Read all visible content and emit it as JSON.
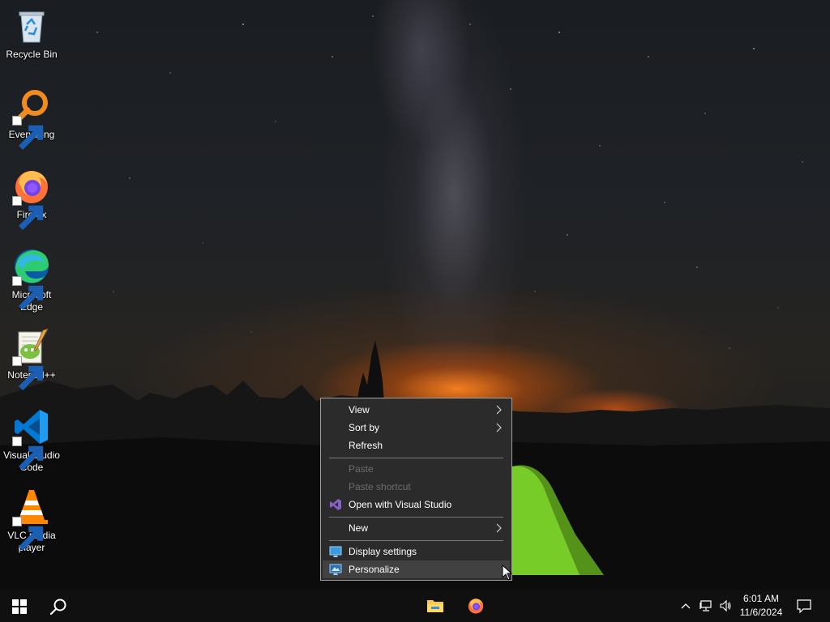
{
  "desktop": {
    "icons": [
      {
        "label": "Recycle Bin",
        "icon": "recycle-bin-icon"
      },
      {
        "label": "Everything",
        "icon": "everything-search-icon"
      },
      {
        "label": "Firefox",
        "icon": "firefox-icon"
      },
      {
        "label": "Microsoft Edge",
        "icon": "edge-icon"
      },
      {
        "label": "Notepad++",
        "icon": "notepad-plus-plus-icon"
      },
      {
        "label": "Visual Studio Code",
        "icon": "vscode-icon"
      },
      {
        "label": "VLC media player",
        "icon": "vlc-icon"
      }
    ]
  },
  "context_menu": {
    "items": {
      "view": "View",
      "sort_by": "Sort by",
      "refresh": "Refresh",
      "paste": "Paste",
      "paste_shortcut": "Paste shortcut",
      "open_with_vs": "Open with Visual Studio",
      "new": "New",
      "display_settings": "Display settings",
      "personalize": "Personalize"
    },
    "disabled_items": [
      "Paste",
      "Paste shortcut"
    ],
    "highlighted_item": "Personalize"
  },
  "taskbar": {
    "pinned": [
      "start-icon",
      "search-icon",
      "file-explorer-icon",
      "firefox-icon"
    ],
    "tray_icons": [
      "chevron-up-icon",
      "network-icon",
      "volume-icon",
      "notification-icon"
    ],
    "time": "6:01 AM",
    "date": "11/6/2024"
  },
  "colors": {
    "menu_bg": "#2b2b2b",
    "menu_hover": "#414141",
    "menu_disabled_text": "#6d6d6d",
    "taskbar_bg": "#101010",
    "vscode_blue": "#0078d4",
    "vs_purple": "#8661c5"
  }
}
